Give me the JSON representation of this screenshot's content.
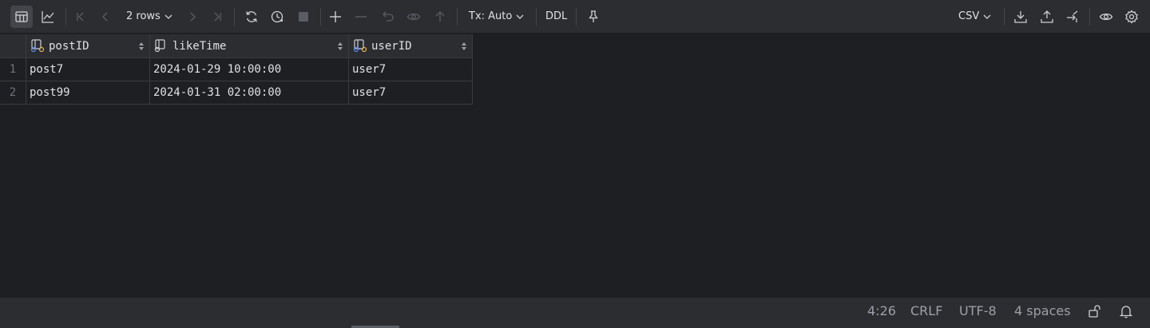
{
  "toolbar": {
    "rows_label": "2 rows",
    "tx_label": "Tx: Auto",
    "ddl_label": "DDL",
    "format_label": "CSV"
  },
  "table": {
    "columns": [
      {
        "name": "postID",
        "icon": "key-column-icon"
      },
      {
        "name": "likeTime",
        "icon": "column-icon"
      },
      {
        "name": "userID",
        "icon": "key-column-icon"
      }
    ],
    "rows": [
      {
        "num": "1",
        "postID": "post7",
        "likeTime": "2024-01-29 10:00:00",
        "userID": "user7"
      },
      {
        "num": "2",
        "postID": "post99",
        "likeTime": "2024-01-31 02:00:00",
        "userID": "user7"
      }
    ]
  },
  "statusbar": {
    "position": "4:26",
    "line_ending": "CRLF",
    "encoding": "UTF-8",
    "indent": "4 spaces"
  },
  "colors": {
    "background": "#1e1f22",
    "panel": "#2b2d30",
    "text": "#dfe1e5",
    "accent": "#548af7"
  }
}
